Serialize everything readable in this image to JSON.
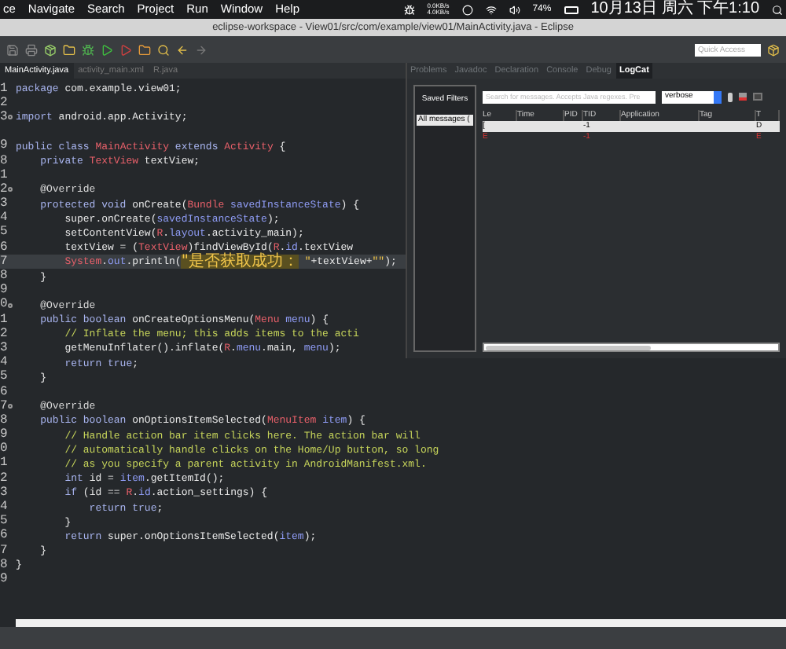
{
  "menu_bar": {
    "items": [
      "ce",
      "Navigate",
      "Search",
      "Project",
      "Run",
      "Window",
      "Help"
    ],
    "net_speed": [
      "0.0KB/s",
      "4.0KB/s"
    ],
    "battery": "74%",
    "clock": "10月13日 周六 下午1:10"
  },
  "window": {
    "title": "eclipse-workspace - View01/src/com/example/view01/MainActivity.java - Eclipse"
  },
  "toolbar": {
    "quick_access": {
      "placeholder": "Quick Access"
    }
  },
  "editor": {
    "tabs": [
      {
        "label": "MainActivity.java",
        "selected": true
      },
      {
        "label": "activity_main.xml",
        "selected": false
      },
      {
        "label": "R.java",
        "selected": false
      }
    ],
    "lines": [
      {
        "number": "1",
        "fold": false,
        "current": false,
        "tokens": [
          {
            "kind": "keyword",
            "text": "package"
          },
          {
            "kind": "plain",
            "text": " com.example.view01;"
          }
        ]
      },
      {
        "number": "2",
        "fold": false,
        "current": false
      },
      {
        "number": "3",
        "fold": true,
        "current": false,
        "tokens": [
          {
            "kind": "keyword",
            "text": "import"
          },
          {
            "kind": "plain",
            "text": " android.app.Activity;"
          }
        ]
      },
      {
        "fold": false,
        "current": false
      },
      {
        "number": "9",
        "fold": false,
        "current": false,
        "tokens": [
          {
            "kind": "keyword",
            "text": "public class "
          },
          {
            "kind": "type",
            "text": "MainActivity"
          },
          {
            "kind": "keyword",
            "text": " extends "
          },
          {
            "kind": "type",
            "text": "Activity"
          },
          {
            "kind": "plain",
            "text": " {"
          }
        ]
      },
      {
        "number": "8",
        "fold": false,
        "current": false,
        "tokens": [
          {
            "kind": "keyword",
            "text": "    private "
          },
          {
            "kind": "type",
            "text": "TextView"
          },
          {
            "kind": "plain",
            "text": " textView;"
          }
        ]
      },
      {
        "number": "1",
        "fold": false,
        "current": false
      },
      {
        "number": "2",
        "fold": true,
        "current": false,
        "tokens": [
          {
            "kind": "annotation",
            "text": "    @Override"
          }
        ]
      },
      {
        "number": "3",
        "fold": false,
        "current": false,
        "tokens": [
          {
            "kind": "keyword",
            "text": "    protected void "
          },
          {
            "kind": "plain",
            "text": "onCreate("
          },
          {
            "kind": "type",
            "text": "Bundle"
          },
          {
            "kind": "field",
            "text": " savedInstanceState"
          },
          {
            "kind": "plain",
            "text": ") {"
          }
        ]
      },
      {
        "number": "4",
        "fold": false,
        "current": false,
        "tokens": [
          {
            "kind": "plain",
            "text": "        super.onCreate("
          },
          {
            "kind": "field",
            "text": "savedInstanceState"
          },
          {
            "kind": "plain",
            "text": ");"
          }
        ]
      },
      {
        "number": "5",
        "fold": false,
        "current": false,
        "tokens": [
          {
            "kind": "plain",
            "text": "        setContentView("
          },
          {
            "kind": "type",
            "text": "R"
          },
          {
            "kind": "plain",
            "text": "."
          },
          {
            "kind": "field",
            "text": "layout"
          },
          {
            "kind": "plain",
            "text": ".activity_main);"
          }
        ]
      },
      {
        "number": "6",
        "fold": false,
        "current": false,
        "tokens": [
          {
            "kind": "plain",
            "text": "        textView = ("
          },
          {
            "kind": "type",
            "text": "TextView"
          },
          {
            "kind": "plain",
            "text": ")findViewById("
          },
          {
            "kind": "type",
            "text": "R"
          },
          {
            "kind": "plain",
            "text": "."
          },
          {
            "kind": "field",
            "text": "id"
          },
          {
            "kind": "plain",
            "text": ".textView"
          }
        ]
      },
      {
        "number": "7",
        "fold": false,
        "current": true,
        "tokens": [
          {
            "kind": "type",
            "text": "        System"
          },
          {
            "kind": "plain",
            "text": "."
          },
          {
            "kind": "field",
            "text": "out"
          },
          {
            "kind": "plain",
            "text": ".println("
          },
          {
            "kind": "string",
            "text": "\"是否获取成功："
          },
          {
            "kind": "string",
            "text": " \""
          },
          {
            "kind": "plain",
            "text": "+textView+"
          },
          {
            "kind": "string",
            "text": "\"\""
          },
          {
            "kind": "plain",
            "text": ");"
          }
        ]
      },
      {
        "number": "8",
        "fold": false,
        "current": false,
        "tokens": [
          {
            "kind": "plain",
            "text": "    }"
          }
        ]
      },
      {
        "number": "9",
        "fold": false,
        "current": false
      },
      {
        "number": "0",
        "fold": true,
        "current": false,
        "tokens": [
          {
            "kind": "annotation",
            "text": "    @Override"
          }
        ]
      },
      {
        "number": "1",
        "fold": false,
        "current": false,
        "tokens": [
          {
            "kind": "keyword",
            "text": "    public boolean "
          },
          {
            "kind": "plain",
            "text": "onCreateOptionsMenu("
          },
          {
            "kind": "type",
            "text": "Menu"
          },
          {
            "kind": "field",
            "text": " menu"
          },
          {
            "kind": "plain",
            "text": ") {"
          }
        ]
      },
      {
        "number": "2",
        "fold": false,
        "current": false,
        "tokens": [
          {
            "kind": "comment",
            "text": "        // Inflate the menu; this adds items to the acti"
          }
        ]
      },
      {
        "number": "3",
        "fold": false,
        "current": false,
        "tokens": [
          {
            "kind": "plain",
            "text": "        getMenuInflater().inflate("
          },
          {
            "kind": "type",
            "text": "R"
          },
          {
            "kind": "plain",
            "text": "."
          },
          {
            "kind": "field",
            "text": "menu"
          },
          {
            "kind": "plain",
            "text": ".main, "
          },
          {
            "kind": "field",
            "text": "menu"
          },
          {
            "kind": "plain",
            "text": ");"
          }
        ]
      },
      {
        "number": "4",
        "fold": false,
        "current": false,
        "tokens": [
          {
            "kind": "keyword",
            "text": "        return true"
          },
          {
            "kind": "plain",
            "text": ";"
          }
        ]
      },
      {
        "number": "5",
        "fold": false,
        "current": false,
        "tokens": [
          {
            "kind": "plain",
            "text": "    }"
          }
        ]
      },
      {
        "number": "6",
        "fold": false,
        "current": false
      },
      {
        "number": "7",
        "fold": true,
        "current": false,
        "tokens": [
          {
            "kind": "annotation",
            "text": "    @Override"
          }
        ]
      },
      {
        "number": "8",
        "fold": false,
        "current": false,
        "tokens": [
          {
            "kind": "keyword",
            "text": "    public boolean "
          },
          {
            "kind": "plain",
            "text": "onOptionsItemSelected("
          },
          {
            "kind": "type",
            "text": "MenuItem"
          },
          {
            "kind": "field",
            "text": " item"
          },
          {
            "kind": "plain",
            "text": ") {"
          }
        ]
      },
      {
        "number": "9",
        "fold": false,
        "current": false,
        "tokens": [
          {
            "kind": "comment",
            "text": "        // Handle action bar item clicks here. The action bar will"
          }
        ]
      },
      {
        "number": "0",
        "fold": false,
        "current": false,
        "tokens": [
          {
            "kind": "comment",
            "text": "        // automatically handle clicks on the Home/Up button, so long"
          }
        ]
      },
      {
        "number": "1",
        "fold": false,
        "current": false,
        "tokens": [
          {
            "kind": "comment",
            "text": "        // as you specify a parent activity in AndroidManifest.xml."
          }
        ]
      },
      {
        "number": "2",
        "fold": false,
        "current": false,
        "tokens": [
          {
            "kind": "keyword",
            "text": "        int"
          },
          {
            "kind": "plain",
            "text": " id = "
          },
          {
            "kind": "field",
            "text": "item"
          },
          {
            "kind": "plain",
            "text": ".getItemId();"
          }
        ]
      },
      {
        "number": "3",
        "fold": false,
        "current": false,
        "tokens": [
          {
            "kind": "keyword",
            "text": "        if"
          },
          {
            "kind": "plain",
            "text": " (id == "
          },
          {
            "kind": "type",
            "text": "R"
          },
          {
            "kind": "plain",
            "text": "."
          },
          {
            "kind": "field",
            "text": "id"
          },
          {
            "kind": "plain",
            "text": ".action_settings) {"
          }
        ]
      },
      {
        "number": "4",
        "fold": false,
        "current": false,
        "tokens": [
          {
            "kind": "keyword",
            "text": "            return true"
          },
          {
            "kind": "plain",
            "text": ";"
          }
        ]
      },
      {
        "number": "5",
        "fold": false,
        "current": false,
        "tokens": [
          {
            "kind": "plain",
            "text": "        }"
          }
        ]
      },
      {
        "number": "6",
        "fold": false,
        "current": false,
        "tokens": [
          {
            "kind": "keyword",
            "text": "        return "
          },
          {
            "kind": "plain",
            "text": "super.onOptionsItemSelected("
          },
          {
            "kind": "field",
            "text": "item"
          },
          {
            "kind": "plain",
            "text": ");"
          }
        ]
      },
      {
        "number": "7",
        "fold": false,
        "current": false,
        "tokens": [
          {
            "kind": "plain",
            "text": "    }"
          }
        ]
      },
      {
        "number": "8",
        "fold": false,
        "current": false,
        "tokens": [
          {
            "kind": "plain",
            "text": "}"
          }
        ]
      },
      {
        "number": "9",
        "fold": false,
        "current": false
      }
    ]
  },
  "logcat": {
    "tabs": [
      {
        "label": "Problems",
        "selected": false
      },
      {
        "label": "Javadoc",
        "selected": false
      },
      {
        "label": "Declaration",
        "selected": false
      },
      {
        "label": "Console",
        "selected": false
      },
      {
        "label": "Debug",
        "selected": false
      },
      {
        "label": "LogCat",
        "selected": true
      }
    ],
    "saved_filters": {
      "title": "Saved Filters",
      "items": [
        {
          "label": "All messages (",
          "selected": true
        }
      ]
    },
    "search": {
      "placeholder": "Search for messages. Accepts Java regexes. Pre"
    },
    "level_select": "verbose",
    "table": {
      "columns": [
        "Le",
        "Time",
        "PID",
        "TID",
        "Application",
        "Tag",
        "T"
      ],
      "rows": [
        {
          "selected": true,
          "error": false,
          "cells": [
            "[",
            "",
            "",
            "-1",
            "",
            "",
            "D"
          ]
        },
        {
          "selected": false,
          "error": true,
          "cells": [
            "E",
            "",
            "",
            "-1",
            "",
            "",
            "E"
          ]
        }
      ]
    }
  }
}
